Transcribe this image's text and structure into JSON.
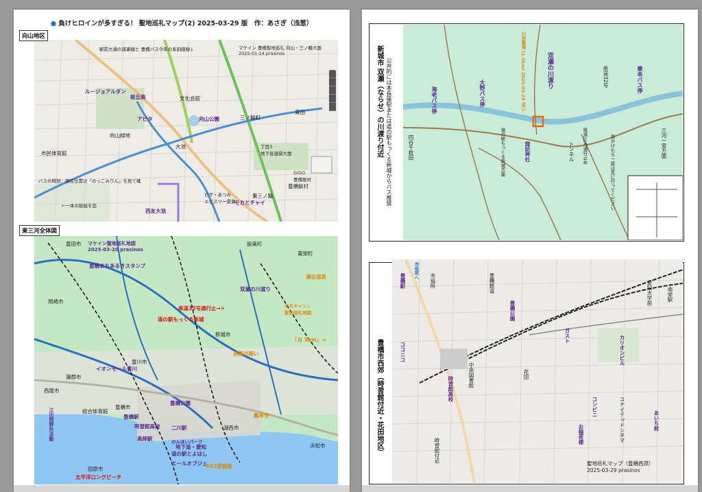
{
  "left_page": {
    "title": "負けヒロインが多すぎる！ 聖地巡礼マップ(2) 2025-03-29 版　作：あさぎ（浅葱）",
    "mukaiyama": {
      "label": "向山地区",
      "notes": {
        "top_left": "駅前大通の諸裏線と\n豊橋バス今年の系割経線↓",
        "top_right": "マケイン 豊橋聖地巡礼 向山・三ノ輪大面\n2025-01-14 prasinos",
        "mid_left": "バスの時刻：現在位置は「のっこみりん」を見て確",
        "bottom_left": "←一本の総絵を迄",
        "gigo": "GiGO\n豊橋飯村"
      },
      "places": [
        "ルージョアルダン",
        "桜丘高",
        "アピタ",
        "向山緑地",
        "文化会館",
        "向山公園",
        "三ノ輪町",
        "丁目3\n地下盲道縁大面",
        "乗三ノ輪",
        "モカとチャイ",
        "ピザ・あつみ\nエビスリー景瀬",
        "西友大池",
        "豊橋飯村",
        "東田",
        "大池",
        "市民体育館"
      ]
    },
    "higashimikawa": {
      "label": "東三河全体図",
      "notes": {
        "title": "マケイン聖地巡礼地図\n2025-03-20 prasinos",
        "stamp": "豊橋まちあるきスタンプ",
        "route32": "県道32号通行止→✕",
        "michinoeki": "道の駅もっくる新城",
        "futase": "双瀬の川渡り",
        "yuru": "ゆるキャン△\n聖地巡礼地図",
        "distance": "「月 3km」→",
        "bottom": "太平洋ロングビーチ"
      },
      "places": [
        "豊田市",
        "設楽町",
        "東栄町",
        "岡崎市",
        "新城市",
        "豊川市",
        "蒲郡市",
        "西尾市",
        "豊橋市",
        "田原市",
        "湖西市",
        "浜松市",
        "豊橋駅",
        "二川駅",
        "豊橋公園",
        "高師駅",
        "総合体育館",
        "イオンモール豊川",
        "時習館高校",
        "地下道・愛知",
        "のんほいパーク",
        "道の駅とよはし",
        "エールオブジェ",
        "R42景観路",
        "湯谷温泉",
        "鳳来寺",
        "長篠の戦い",
        "江比間野外活動"
      ]
    }
  },
  "right_page": {
    "futase": {
      "title": "新城市 双瀬（ならせ）の川渡り付近",
      "subtitle": "公共的には本長篠駅または道の駅もっくる新城からバス推奨",
      "places": [
        "海老バス停",
        "川売集落 (1.5km) 2025-03-29 近い",
        "双瀬の川渡り",
        "大野バス停",
        "四谷千枚田",
        "諏訪神社",
        "乗本バス停",
        "三河一宮方面",
        "トンネル",
        "県道32号"
      ],
      "notes": [
        "見かけたら一度は見に行ってください",
        "道の駅もっくる新城方面",
        "県道32号通行止め"
      ]
    },
    "nishikogo": {
      "title": "豊橋市西郊（時習館付近・花田地区）",
      "places": [
        "豊橋駅",
        "市役所",
        "ココニコ",
        "時習館高校",
        "中央図書館",
        "花田",
        "ガスト",
        "豊橋公園",
        "カリオンビル",
        "南栄駅",
        "豊橋鉄道",
        "愛知大学前",
        "コンビニ",
        "お稲荷様",
        "ユナイテッドシネマ",
        "時習館付近",
        "あいち前"
      ],
      "footer": "聖地巡礼マップ（豊橋西郊）\n2025-03-29 prasinos",
      "top_left": "市役所へ"
    }
  }
}
